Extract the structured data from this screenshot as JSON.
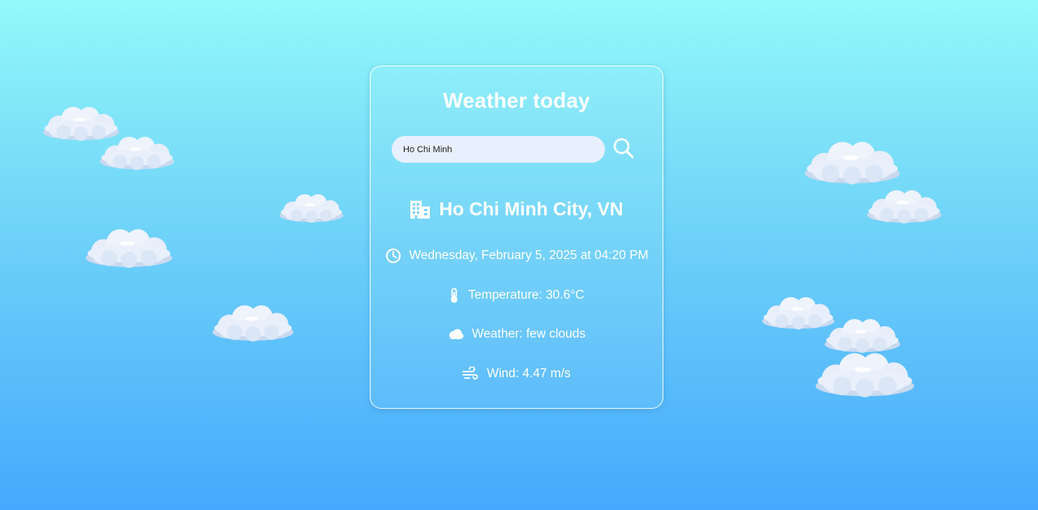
{
  "app": {
    "title": "Weather today"
  },
  "search": {
    "value": "Ho Chi Minh",
    "button_icon": "search-icon"
  },
  "location": {
    "icon": "building-icon",
    "label": "Ho Chi Minh City, VN"
  },
  "details": {
    "datetime": {
      "icon": "clock-icon",
      "text": "Wednesday, February 5, 2025 at 04:20 PM"
    },
    "temperature": {
      "icon": "thermometer-icon",
      "text": "Temperature: 30.6°C"
    },
    "weather": {
      "icon": "cloud-icon",
      "text": "Weather: few clouds"
    },
    "wind": {
      "icon": "wind-icon",
      "text": "Wind: 4.47 m/s"
    }
  },
  "colors": {
    "background_top": "#93f9fa",
    "background_bottom": "#46a9fd",
    "text": "#ffffff",
    "search_field": "#e9f0fd"
  }
}
